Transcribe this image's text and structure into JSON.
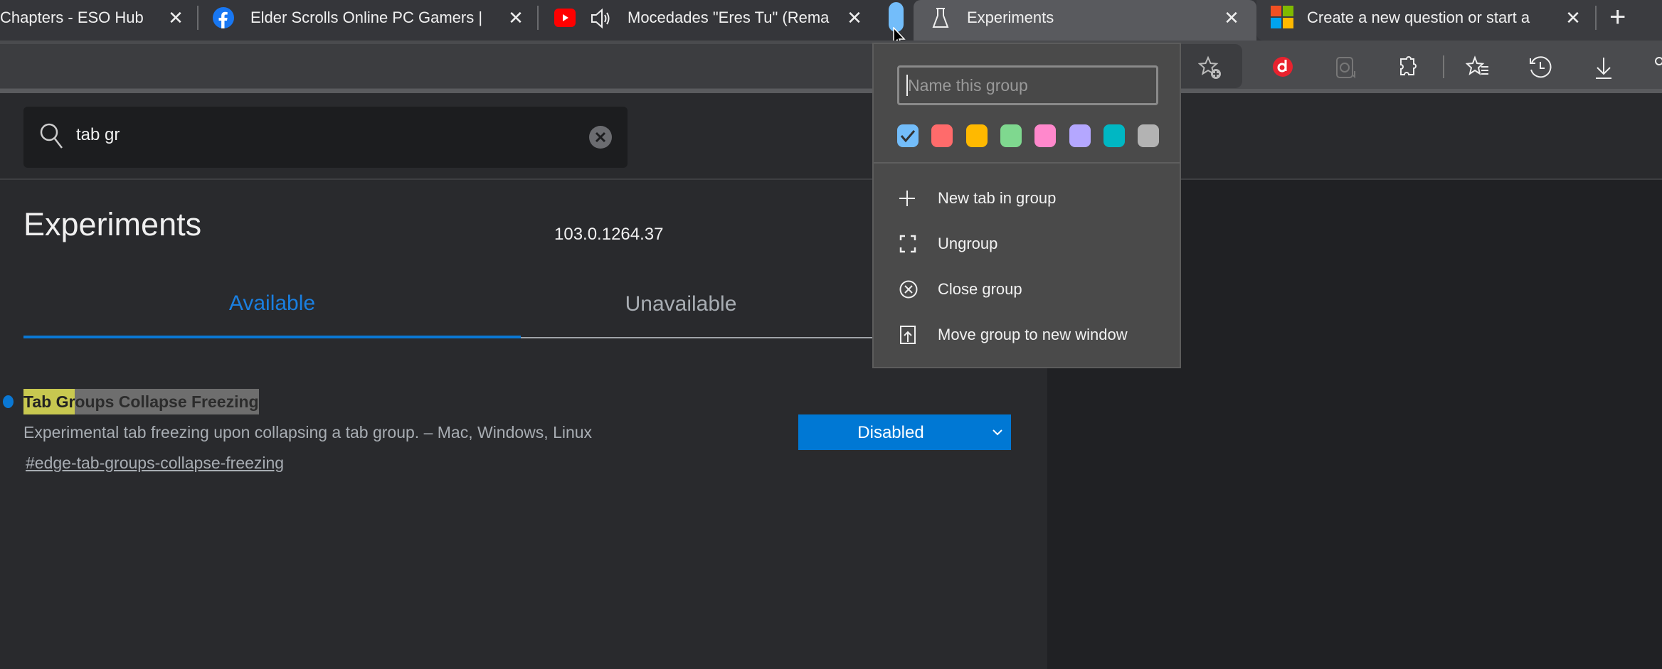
{
  "tabs": [
    {
      "title": "Chapters - ESO Hub",
      "icon": "none"
    },
    {
      "title": "Elder Scrolls Online PC Gamers | ",
      "icon": "facebook-icon"
    },
    {
      "title": "Mocedades \"Eres Tu\" (Rema",
      "icon": "youtube-icon",
      "audio": true
    },
    {
      "title": "Experiments",
      "icon": "flask-icon",
      "active": true
    },
    {
      "title": "Create a new question or start a",
      "icon": "microsoft-icon"
    }
  ],
  "tab_group": {
    "color": "#73bdfa"
  },
  "search": {
    "value": "tab gr"
  },
  "page": {
    "title": "Experiments",
    "version": "103.0.1264.37"
  },
  "page_tabs": {
    "available": "Available",
    "unavailable": "Unavailable",
    "selected": "Available"
  },
  "experiment": {
    "title_highlight": "Tab Gr",
    "title_rest": "oups Collapse Freezing",
    "description": "Experimental tab freezing upon collapsing a tab group. – Mac, Windows, Linux",
    "link": "#edge-tab-groups-collapse-freezing",
    "state": "Disabled"
  },
  "group_menu": {
    "name_placeholder": "Name this group",
    "colors": [
      "#73bdfa",
      "#ff6b6b",
      "#ffb900",
      "#7fd88f",
      "#ff88cc",
      "#b4a7ff",
      "#00b7c3",
      "#b3b3b3"
    ],
    "selected_color": "#73bdfa",
    "items": [
      "New tab in group",
      "Ungroup",
      "Close group",
      "Move group to new window"
    ]
  },
  "colors": {
    "accent": "#0078d4",
    "highlight": "#c8c850"
  }
}
